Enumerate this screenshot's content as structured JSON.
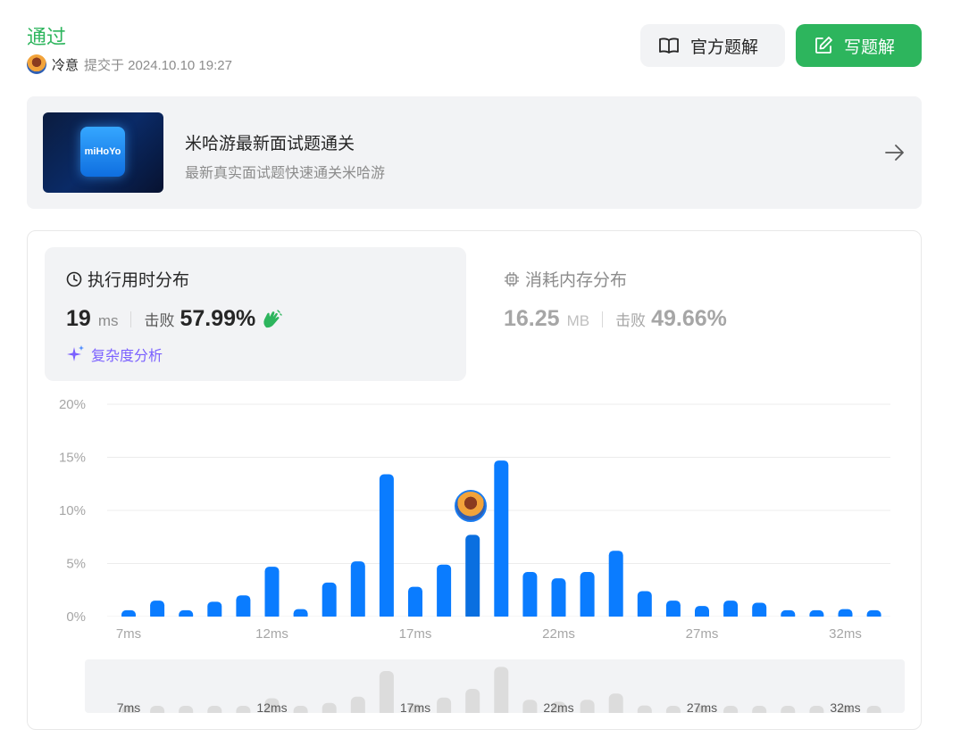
{
  "header": {
    "status": "通过",
    "username": "冷意",
    "submitted_text": "提交于 2024.10.10 19:27"
  },
  "buttons": {
    "official_label": "官方题解",
    "write_label": "写题解"
  },
  "banner": {
    "logo_text": "miHoYo",
    "title": "米哈游最新面试题通关",
    "subtitle": "最新真实面试题快速通关米哈游"
  },
  "runtime": {
    "title": "执行用时分布",
    "value": "19",
    "unit": "ms",
    "beat_label": "击败",
    "beat_value": "57.99%",
    "analysis_label": "复杂度分析"
  },
  "memory": {
    "title": "消耗内存分布",
    "value": "16.25",
    "unit": "MB",
    "beat_label": "击败",
    "beat_value": "49.66%"
  },
  "colors": {
    "accent_green": "#2db55d",
    "bar_blue": "#0a7cff",
    "bar_highlight": "#0a6fe0",
    "overview_bar": "#dcdcdc"
  },
  "chart_data": {
    "type": "bar",
    "x": [
      7,
      8,
      9,
      10,
      11,
      12,
      13,
      14,
      15,
      16,
      17,
      18,
      19,
      20,
      21,
      22,
      23,
      24,
      25,
      26,
      27,
      28,
      29,
      30,
      31,
      32,
      33
    ],
    "values": [
      0.6,
      1.5,
      0.6,
      1.4,
      2.0,
      4.7,
      0.7,
      3.2,
      5.2,
      13.4,
      2.8,
      4.9,
      7.7,
      14.7,
      4.2,
      3.6,
      4.2,
      6.2,
      2.4,
      1.5,
      1.0,
      1.5,
      1.3,
      0.6,
      0.6,
      0.7,
      0.6
    ],
    "highlight_x": 19,
    "y_ticks": [
      "20%",
      "15%",
      "10%",
      "5%",
      "0%"
    ],
    "y_tick_values": [
      20,
      15,
      10,
      5,
      0
    ],
    "x_tick_labels": [
      "7ms",
      "12ms",
      "17ms",
      "22ms",
      "27ms",
      "32ms"
    ],
    "x_tick_values": [
      7,
      12,
      17,
      22,
      27,
      32
    ],
    "ylim": [
      0,
      20
    ],
    "grid": true
  }
}
